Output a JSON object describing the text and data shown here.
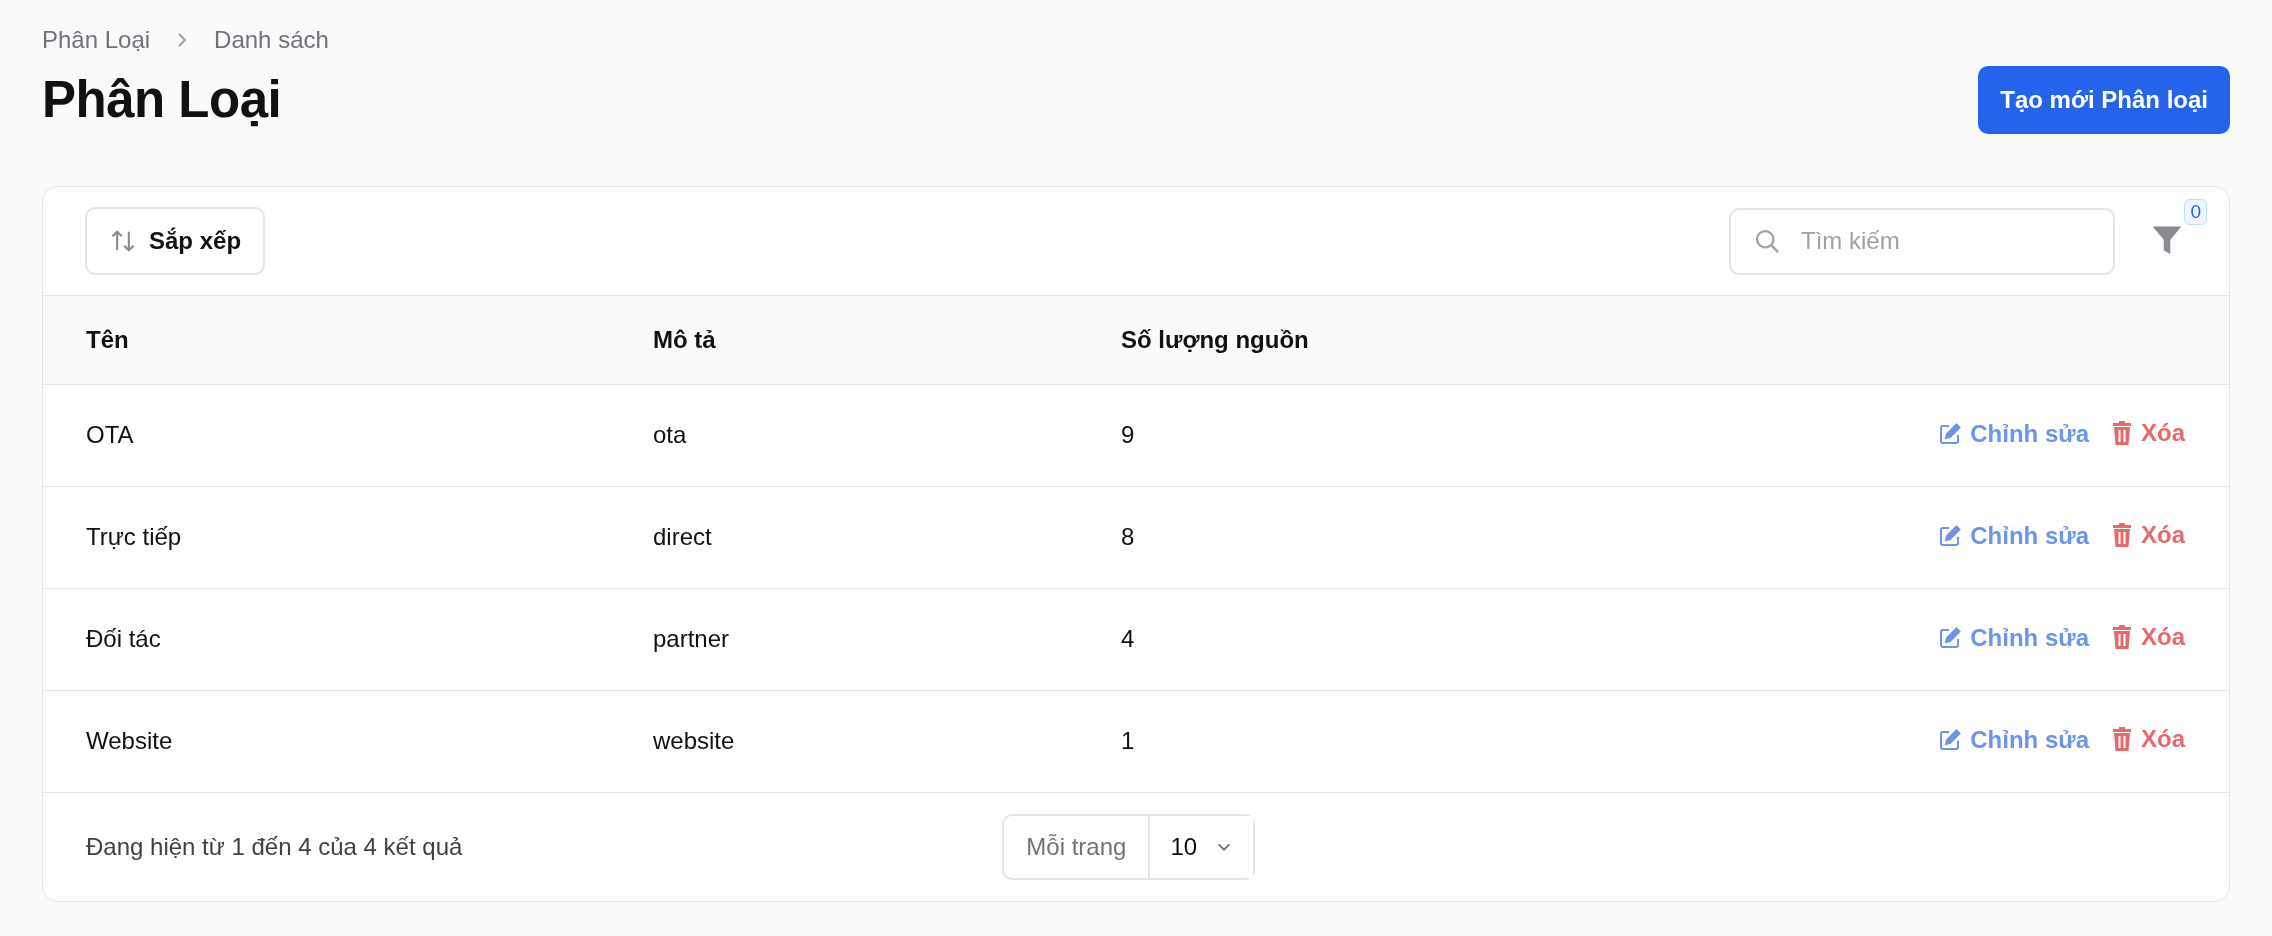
{
  "breadcrumb": [
    {
      "label": "Phân Loại"
    },
    {
      "label": "Danh sách"
    }
  ],
  "title": "Phân Loại",
  "create_button": "Tạo mới Phân loại",
  "toolbar": {
    "sort_button": "Sắp xếp",
    "search": {
      "placeholder": "Tìm kiếm"
    },
    "filter_count": "0"
  },
  "table": {
    "columns": [
      "Tên",
      "Mô tả",
      "Số lượng nguồn"
    ],
    "rows": [
      {
        "cells": [
          "OTA",
          "ota",
          "9"
        ],
        "actions": [
          "Chỉnh sửa",
          "Xóa"
        ]
      },
      {
        "cells": [
          "Trực tiếp",
          "direct",
          "8"
        ],
        "actions": [
          "Chỉnh sửa",
          "Xóa"
        ]
      },
      {
        "cells": [
          "Đối tác",
          "partner",
          "4"
        ],
        "actions": [
          "Chỉnh sửa",
          "Xóa"
        ]
      },
      {
        "cells": [
          "Website",
          "website",
          "1"
        ],
        "actions": [
          "Chỉnh sửa",
          "Xóa"
        ]
      }
    ]
  },
  "pagination": {
    "summary": "Đang hiện từ 1 đến 4 của 4 kết quả",
    "per_page_label": "Mỗi trang",
    "per_page_value": "10"
  }
}
